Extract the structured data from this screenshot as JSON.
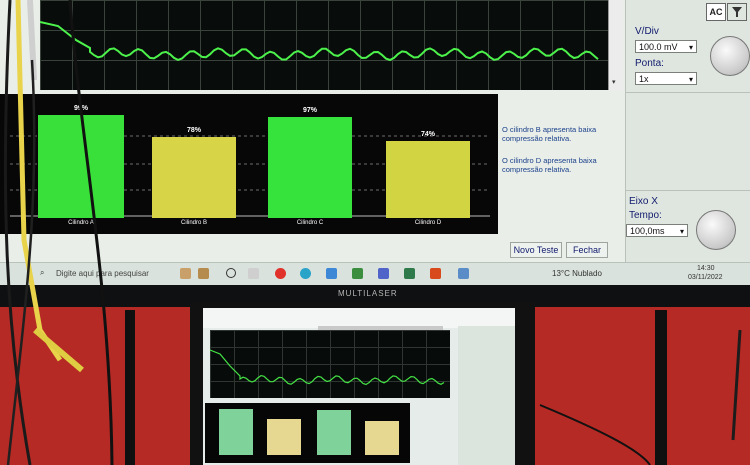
{
  "upper_screen": {
    "controls": {
      "coupling": "AC",
      "vdiv_label": "V/Div",
      "vdiv_value": "100.0 mV",
      "probe_label": "Ponta:",
      "probe_value": "1x",
      "axis_label": "Eixo X",
      "time_label": "Tempo:",
      "time_value": "100,0ms"
    },
    "bars": [
      {
        "pct": "99%",
        "name": "Cilindro A",
        "value": 99,
        "color": "#39e03a"
      },
      {
        "pct": "78%",
        "name": "Cilindro B",
        "value": 78,
        "color": "#d7d447"
      },
      {
        "pct": "97%",
        "name": "Cilindro C",
        "value": 97,
        "color": "#36e33c"
      },
      {
        "pct": "74%",
        "name": "Cilindro D",
        "value": 74,
        "color": "#d2d441"
      }
    ],
    "messages": [
      "O cilindro B apresenta baixa compressão relativa.",
      "O cilindro D apresenta baixa compressão relativa."
    ],
    "buttons": {
      "new_test": "Novo Teste",
      "close": "Fechar"
    },
    "taskbar": {
      "search_placeholder": "Digite aqui para pesquisar",
      "weather": "13°C  Nublado",
      "time": "14:30",
      "date": "03/11/2022"
    }
  },
  "monitor_brand": "MULTILASER",
  "lower_screen": {
    "bars": [
      {
        "value": 99,
        "color": "#7fd39a"
      },
      {
        "value": 78,
        "color": "#e6d891"
      },
      {
        "value": 97,
        "color": "#7fd39a"
      },
      {
        "value": 74,
        "color": "#e6d891"
      }
    ]
  }
}
